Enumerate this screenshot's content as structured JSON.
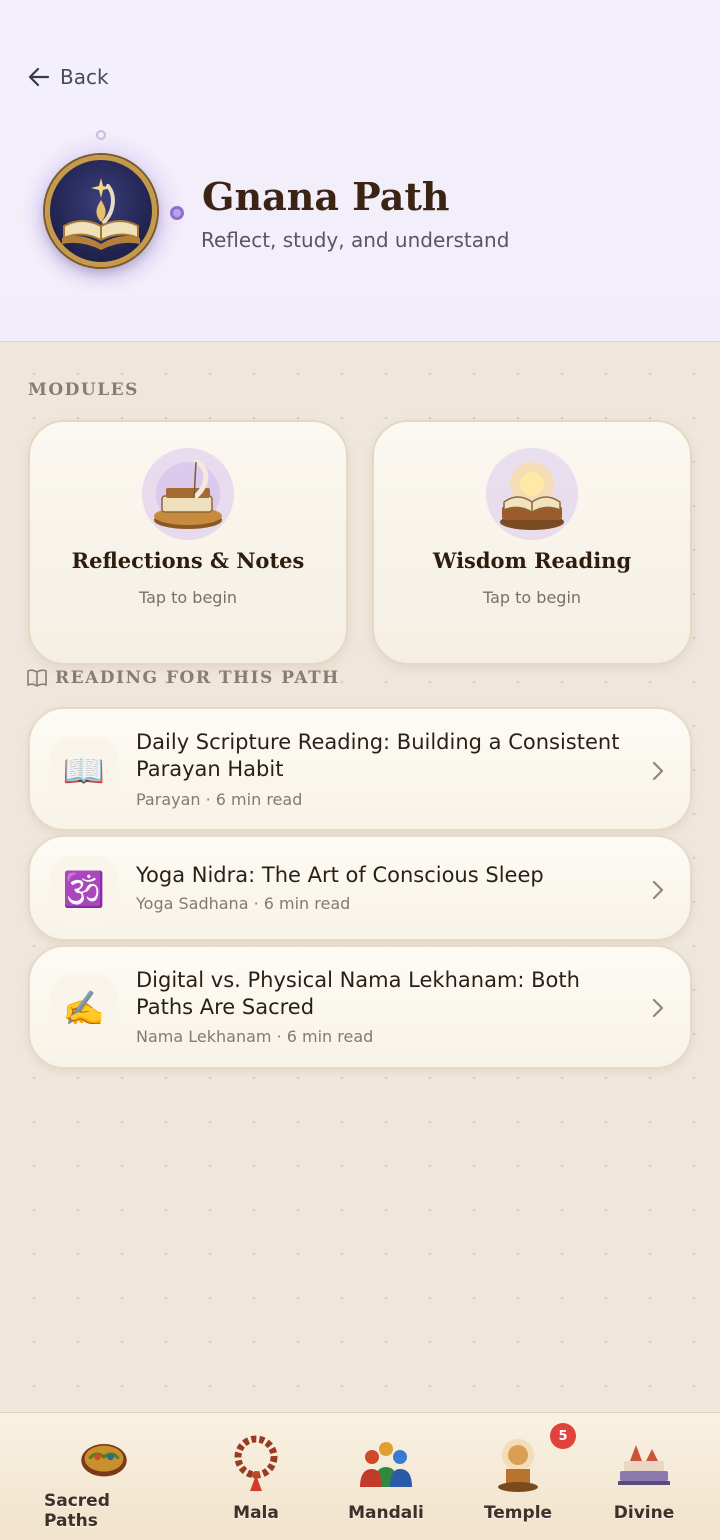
{
  "header": {
    "back_label": "Back",
    "title": "Gnana Path",
    "subtitle": "Reflect, study, and understand"
  },
  "modules": {
    "section_label": "MODULES",
    "items": [
      {
        "title": "Reflections & Notes",
        "subtitle": "Tap to begin",
        "icon": "quill-book-icon"
      },
      {
        "title": "Wisdom Reading",
        "subtitle": "Tap to begin",
        "icon": "glowing-book-icon"
      }
    ]
  },
  "reading": {
    "section_label": "READING FOR THIS PATH",
    "articles": [
      {
        "emoji": "📖",
        "title": "Daily Scripture Reading: Building a Consistent Parayan Habit",
        "meta": "Parayan · 6 min read"
      },
      {
        "emoji": "🕉️",
        "title": "Yoga Nidra: The Art of Conscious Sleep",
        "meta": "Yoga Sadhana · 6 min read"
      },
      {
        "emoji": "✍️",
        "title": "Digital vs. Physical Nama Lekhanam: Both Paths Are Sacred",
        "meta": "Nama Lekhanam · 6 min read"
      }
    ]
  },
  "bottom_nav": {
    "items": [
      {
        "label": "Sacred Paths",
        "icon": "sacred-paths-icon"
      },
      {
        "label": "Mala",
        "icon": "mala-icon"
      },
      {
        "label": "Mandali",
        "icon": "mandali-icon"
      },
      {
        "label": "Temple",
        "icon": "temple-icon",
        "badge": "5"
      },
      {
        "label": "Divine",
        "icon": "divine-icon"
      }
    ]
  },
  "colors": {
    "header_bg": "#f2eefa",
    "page_bg": "#efe7dc",
    "title": "#3b2414",
    "badge": "#e0433b"
  }
}
